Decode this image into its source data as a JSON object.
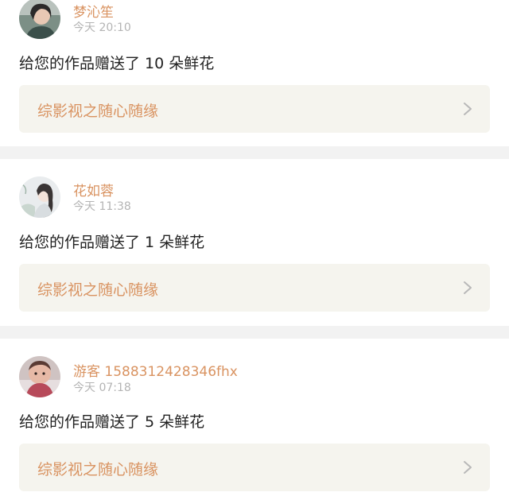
{
  "notifications": [
    {
      "username": "梦沁笙",
      "time": "今天 20:10",
      "message": "给您的作品赠送了 10 朵鲜花",
      "work_title": "综影视之随心随缘",
      "avatar_icon": "user-avatar-photo"
    },
    {
      "username": "花如蓉",
      "time": "今天 11:38",
      "message": "给您的作品赠送了 1 朵鲜花",
      "work_title": "综影视之随心随缘",
      "avatar_icon": "user-avatar-illustration"
    },
    {
      "username": "游客 1588312428346fhx",
      "time": "今天 07:18",
      "message": "给您的作品赠送了 5 朵鲜花",
      "work_title": "综影视之随心随缘",
      "avatar_icon": "user-avatar-baby-photo"
    }
  ],
  "colors": {
    "accent": "#d99361",
    "timestamp": "#b4b4b4",
    "message": "#222222",
    "work_link_bg": "#f5f4ee",
    "separator": "#f2f2f2"
  },
  "icons": {
    "chevron": "chevron-right-icon"
  }
}
